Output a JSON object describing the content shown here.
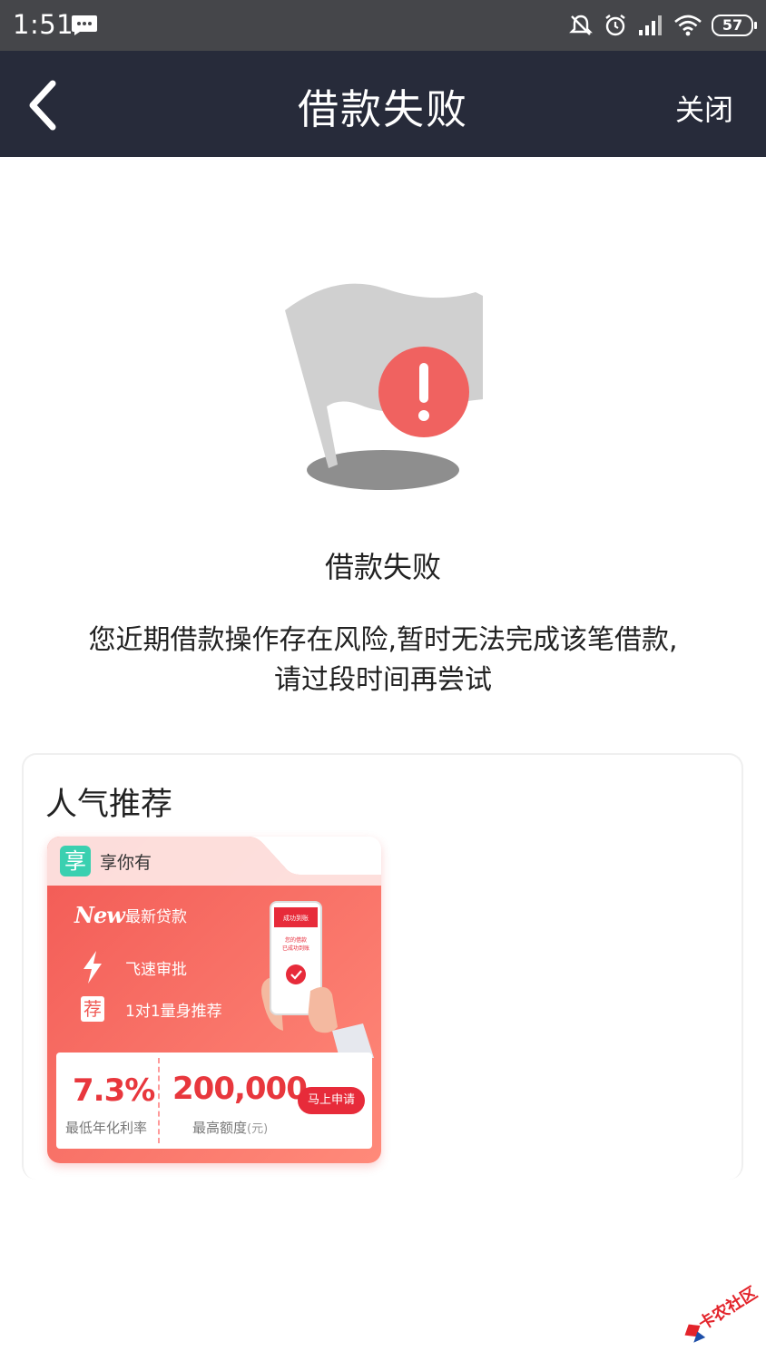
{
  "status_bar": {
    "time": "1:51",
    "battery": "57",
    "icons": [
      "message-icon",
      "mute-icon",
      "alarm-icon",
      "signal-icon",
      "wifi-icon",
      "battery-icon"
    ]
  },
  "nav": {
    "title": "借款失败",
    "close_label": "关闭",
    "bg_color": "#272b3a"
  },
  "result": {
    "icon": "failure-flag-icon",
    "title": "借款失败",
    "description_line1": "您近期借款操作存在风险,暂时无法完成该笔借款,",
    "description_line2": "请过段时间再尝试"
  },
  "recommend": {
    "title": "人气推荐",
    "product": {
      "brand_name": "享你有",
      "brand_logo_char": "享",
      "new_badge": "New",
      "tag_char": "荐",
      "features": [
        "最新贷款",
        "飞速审批",
        "1对1量身推荐"
      ],
      "phone_screen_title": "成功到账",
      "phone_screen_text1": "您的借款",
      "phone_screen_text2": "已成功到账",
      "rate_value": "7.3%",
      "rate_label": "最低年化利率",
      "amount_value": "200,000",
      "amount_label": "最高额度",
      "amount_unit": "(元)",
      "apply_label": "马上申请",
      "accent_color": "#e72b3a"
    }
  },
  "watermark": {
    "text": "卡农社区"
  }
}
